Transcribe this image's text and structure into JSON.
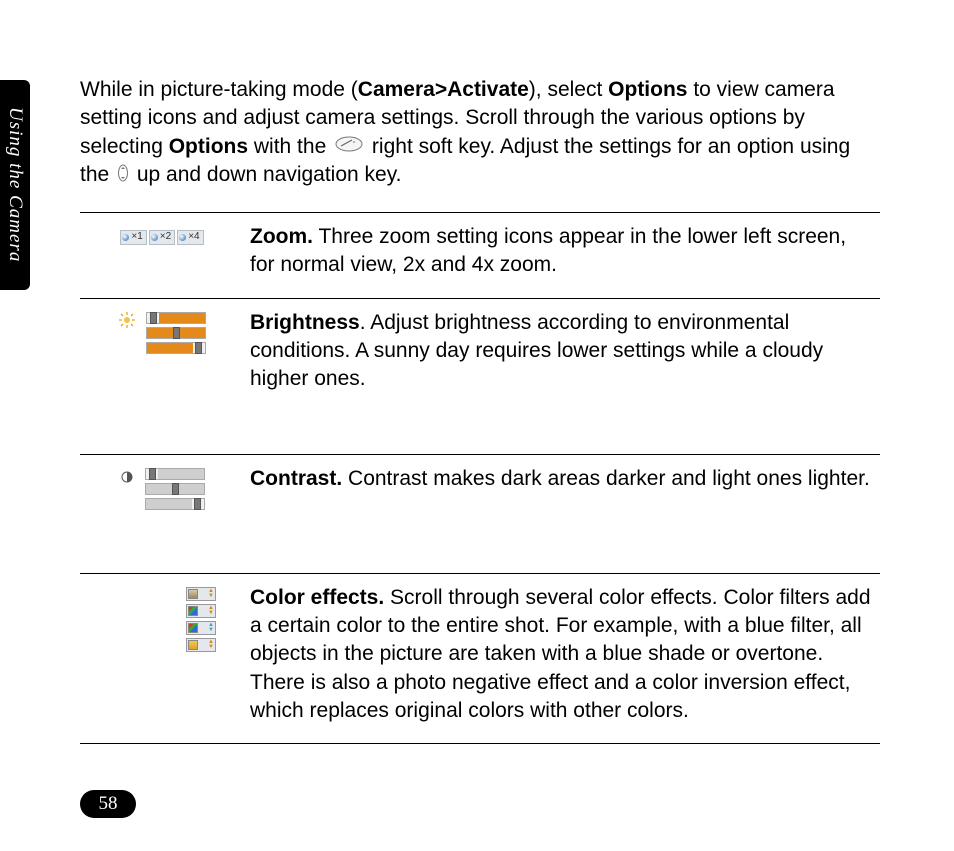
{
  "sideTab": "Using the Camera",
  "pageNumber": "58",
  "intro": {
    "p1a": "While in picture-taking mode (",
    "p1b": "Camera>Activate",
    "p1c": "), select ",
    "p1d": "Options",
    "p1e": " to view camera setting icons and adjust camera settings. Scroll through the various options by selecting ",
    "p1f": "Options",
    "p1g": " with the ",
    "p1h": " right soft key. Adjust the settings for an option using the ",
    "p1i": " up and down navigation key."
  },
  "rows": {
    "zoom": {
      "title": "Zoom.",
      "text": " Three zoom setting icons appear in the lower left screen, for normal view, 2x and 4x zoom.",
      "labels": {
        "x1": "×1",
        "x2": "×2",
        "x4": "×4"
      }
    },
    "brightness": {
      "title": "Brightness",
      "text": ". Adjust brightness according to environmental conditions. A sunny day requires lower settings while a cloudy higher ones."
    },
    "contrast": {
      "title": "Contrast.",
      "text": " Contrast makes dark areas darker and light ones lighter."
    },
    "colorfx": {
      "title": "Color effects.",
      "text": " Scroll through several color effects. Color filters add a certain color to the entire shot. For example, with a blue filter, all objects in the picture are taken with a blue shade or overtone. There is also a photo negative effect and a color inversion effect, which replaces original colors with other colors."
    }
  }
}
